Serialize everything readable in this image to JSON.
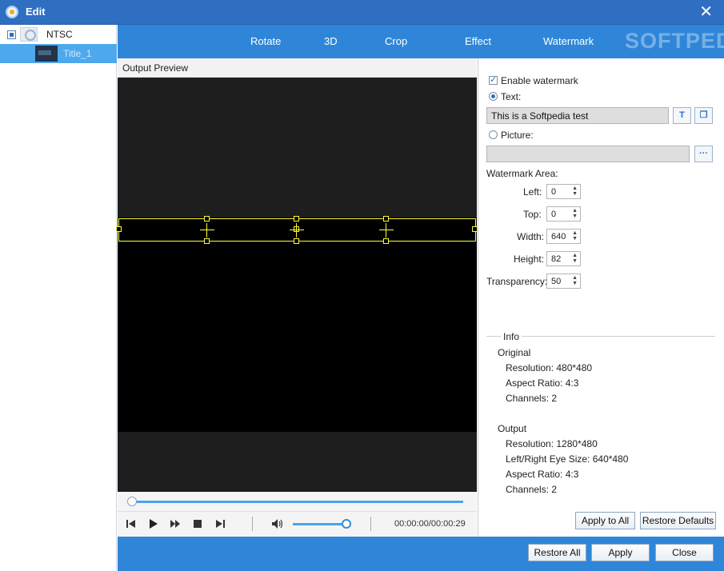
{
  "window": {
    "title": "Edit"
  },
  "sidebar": {
    "items": [
      {
        "label": "NTSC"
      },
      {
        "label": "Title_1"
      }
    ]
  },
  "tabs": [
    {
      "label": "Rotate"
    },
    {
      "label": "3D"
    },
    {
      "label": "Crop"
    },
    {
      "label": "Effect"
    },
    {
      "label": "Watermark"
    }
  ],
  "header_watermark": "SOFTPEDIA",
  "preview": {
    "label": "Output Preview",
    "time": "00:00:00/00:00:29",
    "seek_progress": 0.0,
    "volume_level": 0.9
  },
  "watermark": {
    "enable_label": "Enable watermark",
    "text_label": "Text:",
    "text_value": "This is a Softpedia test",
    "text_btn_glyph": "T",
    "picture_label": "Picture:",
    "picture_value": "",
    "browse_label": "···",
    "area_label": "Watermark Area:",
    "fields": [
      {
        "label": "Left:",
        "value": "0"
      },
      {
        "label": "Top:",
        "value": "0"
      },
      {
        "label": "Width:",
        "value": "640"
      },
      {
        "label": "Height:",
        "value": "82"
      },
      {
        "label": "Transparency:",
        "value": "50"
      }
    ]
  },
  "info": {
    "legend": "Info",
    "original_title": "Original",
    "original": {
      "resolution": "Resolution: 480*480",
      "aspect": "Aspect Ratio: 4:3",
      "channels": "Channels: 2"
    },
    "output_title": "Output",
    "output": {
      "resolution": "Resolution: 1280*480",
      "eye_size": "Left/Right Eye Size: 640*480",
      "aspect": "Aspect Ratio: 4:3",
      "channels": "Channels: 2"
    }
  },
  "buttons": {
    "apply_all": "Apply to All",
    "restore_defaults": "Restore Defaults",
    "restore_all": "Restore All",
    "apply": "Apply",
    "close": "Close"
  },
  "colors": {
    "titlebar": "#2f6fc2",
    "accent": "#2f86d8",
    "selection_box": "#ffff33"
  }
}
